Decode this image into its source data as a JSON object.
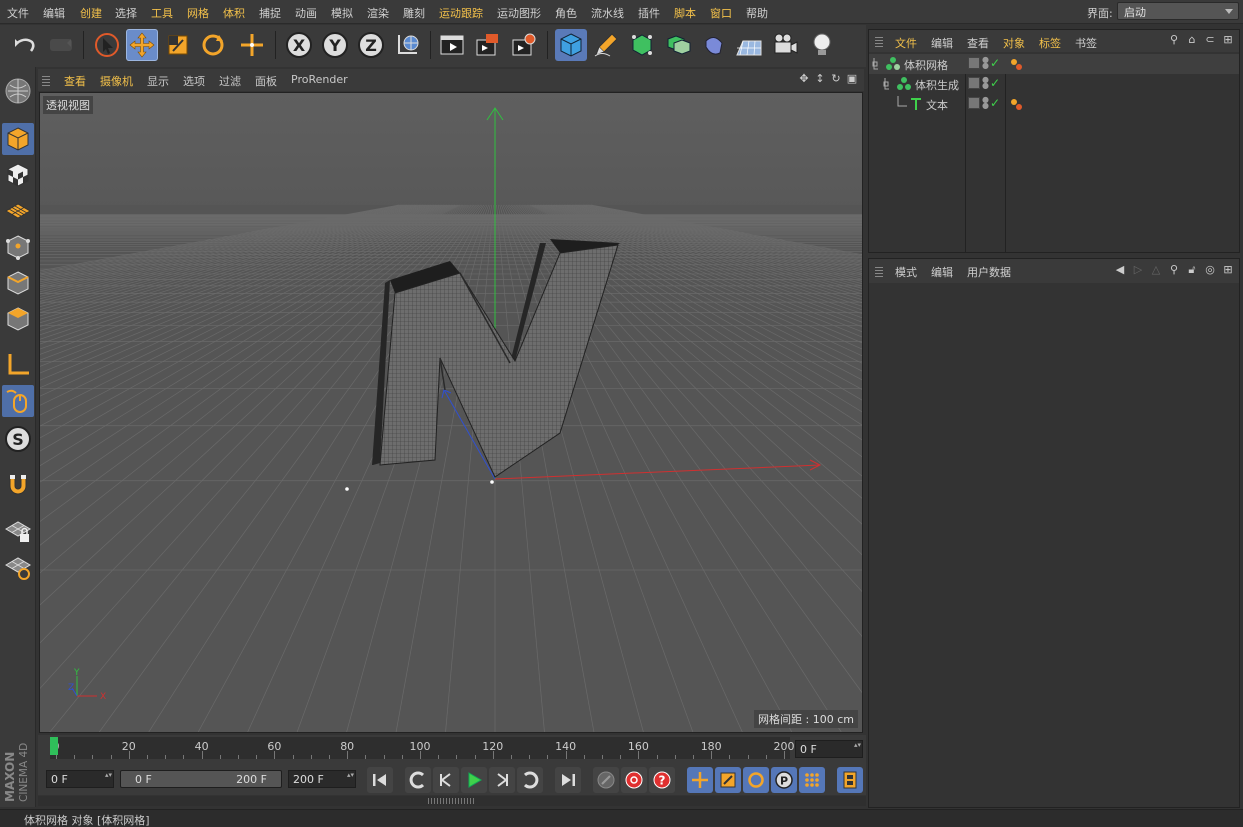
{
  "menubar": {
    "items": [
      "文件",
      "编辑",
      "创建",
      "选择",
      "工具",
      "网格",
      "体积",
      "捕捉",
      "动画",
      "模拟",
      "渲染",
      "雕刻",
      "运动跟踪",
      "运动图形",
      "角色",
      "流水线",
      "插件",
      "脚本",
      "窗口",
      "帮助"
    ],
    "highlighted": [
      2,
      4,
      5,
      6,
      12,
      17,
      18
    ],
    "layout_label": "界面:",
    "layout_value": "启动"
  },
  "toolbar": {
    "axis_x": "X",
    "axis_y": "Y",
    "axis_z": "Z",
    "icons": [
      "undo-icon",
      "redo-icon",
      "live-select-icon",
      "move-icon",
      "scale-icon",
      "rotate-icon",
      "recent-tool-icon",
      "lock-x-icon",
      "lock-y-icon",
      "lock-z-icon",
      "coordinate-system-icon",
      "render-view-icon",
      "render-picture-viewer-icon",
      "render-settings-icon",
      "cube-icon",
      "pen-icon",
      "subdivision-icon",
      "array-icon",
      "deformer-icon",
      "floor-icon",
      "camera-icon",
      "light-icon"
    ]
  },
  "viewport": {
    "menu": [
      "查看",
      "摄像机",
      "显示",
      "选项",
      "过滤",
      "面板",
      "ProRender"
    ],
    "highlighted": [
      0,
      1
    ],
    "label": "透视视图",
    "grid_info": "网格间距 : 100 cm",
    "axis_y": "Y",
    "axis_z": "Z",
    "axis_x": "X"
  },
  "timeline": {
    "ticks": [
      "0",
      "20",
      "40",
      "60",
      "80",
      "100",
      "120",
      "140",
      "160",
      "180",
      "200"
    ],
    "current_frame": "0 F",
    "start_frame": "0 F",
    "range_start": "0 F",
    "range_end": "200 F",
    "end_frame": "200 F"
  },
  "object_manager": {
    "menu": [
      "文件",
      "编辑",
      "查看",
      "对象",
      "标签",
      "书签"
    ],
    "highlighted": [
      0,
      3,
      4
    ],
    "objects": [
      {
        "name": "体积网格",
        "indent": 0
      },
      {
        "name": "体积生成",
        "indent": 1
      },
      {
        "name": "文本",
        "indent": 2
      }
    ]
  },
  "attribute_manager": {
    "menu": [
      "模式",
      "编辑",
      "用户数据"
    ]
  },
  "statusbar": {
    "text": "体积网格 对象 [体积网格]"
  },
  "branding": {
    "maxon": "MAXON",
    "product": "CINEMA 4D"
  },
  "colors": {
    "accent_yellow": "#f2c04a",
    "active_blue": "#6a8cc9",
    "axis_x": "#e03030",
    "axis_y": "#30c040",
    "axis_z": "#3050d0",
    "playhead": "#2fbf5a"
  }
}
